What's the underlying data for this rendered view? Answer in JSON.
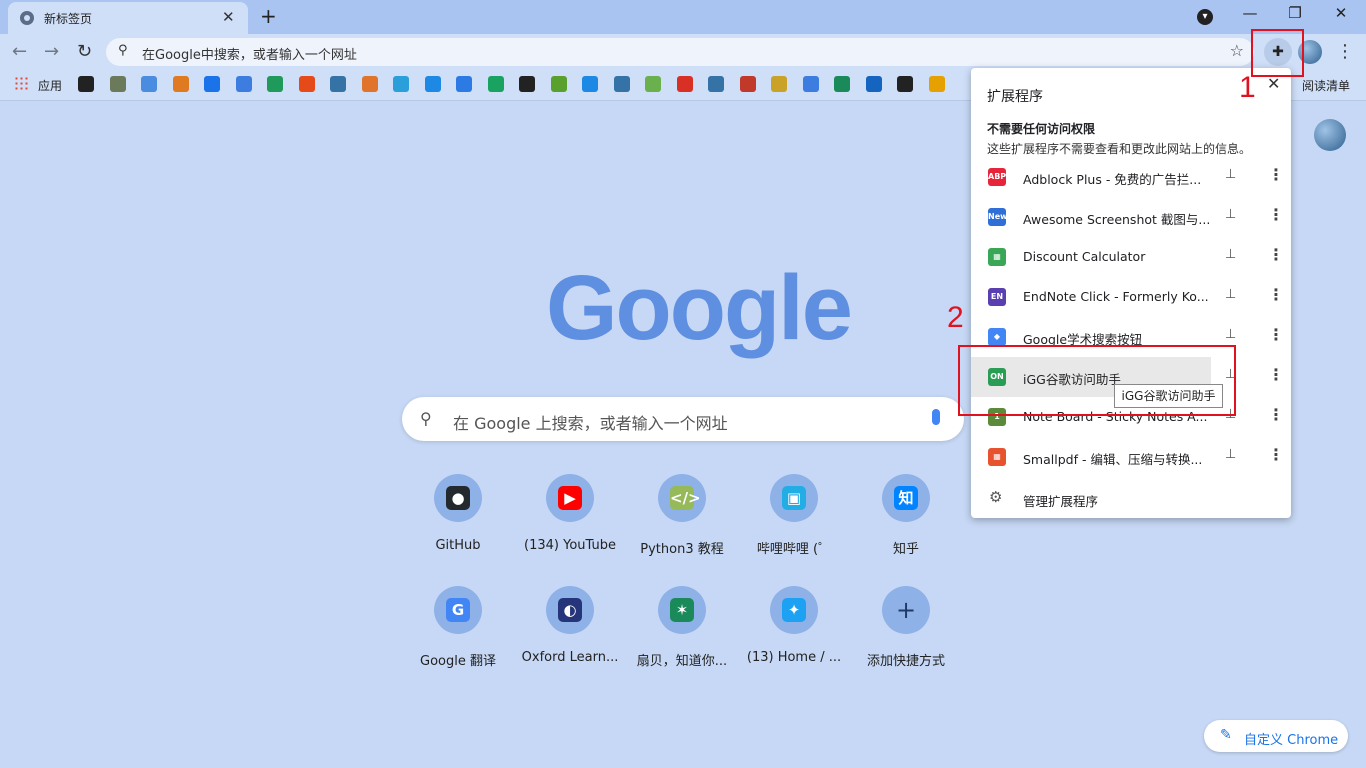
{
  "browser": {
    "tab_title": "新标签页",
    "omnibox_placeholder": "在Google中搜索，或者输入一个网址",
    "apps_label": "应用",
    "reading_list_label": "阅读清单"
  },
  "bookmarks": [
    {
      "color": "#222"
    },
    {
      "color": "#6a7a5a"
    },
    {
      "color": "#4a8de0"
    },
    {
      "color": "#e07a20"
    },
    {
      "color": "#1a73e8"
    },
    {
      "color": "#3d7de0"
    },
    {
      "color": "#1f9a5a"
    },
    {
      "color": "#e64a19"
    },
    {
      "color": "#3572a5"
    },
    {
      "color": "#e0742d"
    },
    {
      "color": "#2b9fd9"
    },
    {
      "color": "#1e88e5"
    },
    {
      "color": "#2c7be5"
    },
    {
      "color": "#1aa260"
    },
    {
      "color": "#222"
    },
    {
      "color": "#5aa02c"
    },
    {
      "color": "#1e88e5"
    },
    {
      "color": "#3572a5"
    },
    {
      "color": "#6ab04c"
    },
    {
      "color": "#d93025"
    },
    {
      "color": "#3572a5"
    },
    {
      "color": "#c0392b"
    },
    {
      "color": "#c9a227"
    },
    {
      "color": "#3d7de0"
    },
    {
      "color": "#1a8a5a"
    },
    {
      "color": "#1565c0"
    },
    {
      "color": "#222"
    },
    {
      "color": "#e6a100"
    }
  ],
  "ntp": {
    "logo_text": "Google",
    "search_placeholder": "在 Google 上搜索，或者输入一个网址",
    "shortcuts": [
      {
        "label": "GitHub",
        "icon": "github-icon",
        "glyph": "●",
        "bg": "#24292e"
      },
      {
        "label": "(134) YouTube",
        "icon": "youtube-icon",
        "glyph": "▶",
        "bg": "#ff0000"
      },
      {
        "label": "Python3 教程",
        "icon": "runoob-icon",
        "glyph": "</>",
        "bg": "#96b95a"
      },
      {
        "label": "哔哩哔哩 (゜",
        "icon": "bilibili-icon",
        "glyph": "▣",
        "bg": "#23ade5"
      },
      {
        "label": "知乎",
        "icon": "zhihu-icon",
        "glyph": "知",
        "bg": "#0084ff"
      },
      {
        "label": "Google 翻译",
        "icon": "google-translate-icon",
        "glyph": "G",
        "bg": "#4285f4"
      },
      {
        "label": "Oxford Learn...",
        "icon": "oxford-icon",
        "glyph": "◐",
        "bg": "#26357a"
      },
      {
        "label": "扇贝，知道你...",
        "icon": "shanbay-icon",
        "glyph": "✶",
        "bg": "#1a8a5a"
      },
      {
        "label": "(13) Home / ...",
        "icon": "twitter-icon",
        "glyph": "✦",
        "bg": "#1da1f2"
      },
      {
        "label": "添加快捷方式",
        "icon": "add-icon",
        "glyph": "+",
        "bg": "transparent"
      }
    ],
    "customize_label": "自定义 Chrome"
  },
  "extensions_popup": {
    "title": "扩展程序",
    "section_heading": "不需要任何访问权限",
    "section_desc": "这些扩展程序不需要查看和更改此网站上的信息。",
    "items": [
      {
        "name": "Adblock Plus - 免费的广告拦...",
        "icon": "adblock-plus-icon",
        "badge": "ABP",
        "color": "#e5263a"
      },
      {
        "name": "Awesome Screenshot 截图与...",
        "icon": "awesome-screenshot-icon",
        "badge": "New",
        "color": "#2f6fd6"
      },
      {
        "name": "Discount Calculator",
        "icon": "calculator-icon",
        "badge": "▦",
        "color": "#3aa757"
      },
      {
        "name": "EndNote Click - Formerly Ko...",
        "icon": "endnote-icon",
        "badge": "EN",
        "color": "#5a3fb0"
      },
      {
        "name": "Google学术搜索按钮",
        "icon": "google-scholar-icon",
        "badge": "◆",
        "color": "#4285f4"
      },
      {
        "name": "iGG谷歌访问助手",
        "icon": "igg-icon",
        "badge": "ON",
        "color": "#2a9d55"
      },
      {
        "name": "Note Board - Sticky Notes A...",
        "icon": "note-board-icon",
        "badge": "1",
        "color": "#5a8a3a"
      },
      {
        "name": "Smallpdf - 编辑、压缩与转换...",
        "icon": "smallpdf-icon",
        "badge": "▦",
        "color": "#e6532e"
      }
    ],
    "manage_label": "管理扩展程序",
    "tooltip": "iGG谷歌访问助手"
  },
  "annotations": {
    "step1": "1",
    "step2": "2"
  }
}
